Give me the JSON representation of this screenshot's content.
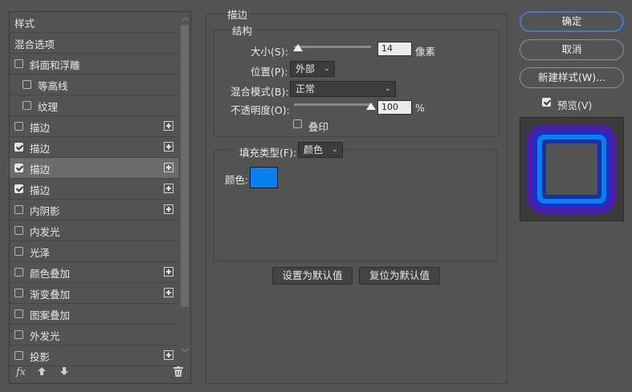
{
  "styles_list": {
    "items": [
      {
        "label": "样式",
        "checkbox": false,
        "checked": false,
        "plus": false,
        "indent": false,
        "selected": false
      },
      {
        "label": "混合选项",
        "checkbox": false,
        "checked": false,
        "plus": false,
        "indent": false,
        "selected": false
      },
      {
        "label": "斜面和浮雕",
        "checkbox": true,
        "checked": false,
        "plus": false,
        "indent": false,
        "selected": false
      },
      {
        "label": "等高线",
        "checkbox": true,
        "checked": false,
        "plus": false,
        "indent": true,
        "selected": false
      },
      {
        "label": "纹理",
        "checkbox": true,
        "checked": false,
        "plus": false,
        "indent": true,
        "selected": false
      },
      {
        "label": "描边",
        "checkbox": true,
        "checked": false,
        "plus": true,
        "indent": false,
        "selected": false
      },
      {
        "label": "描边",
        "checkbox": true,
        "checked": true,
        "plus": true,
        "indent": false,
        "selected": false
      },
      {
        "label": "描边",
        "checkbox": true,
        "checked": true,
        "plus": true,
        "indent": false,
        "selected": true
      },
      {
        "label": "描边",
        "checkbox": true,
        "checked": true,
        "plus": true,
        "indent": false,
        "selected": false
      },
      {
        "label": "内阴影",
        "checkbox": true,
        "checked": false,
        "plus": true,
        "indent": false,
        "selected": false
      },
      {
        "label": "内发光",
        "checkbox": true,
        "checked": false,
        "plus": false,
        "indent": false,
        "selected": false
      },
      {
        "label": "光泽",
        "checkbox": true,
        "checked": false,
        "plus": false,
        "indent": false,
        "selected": false
      },
      {
        "label": "颜色叠加",
        "checkbox": true,
        "checked": false,
        "plus": true,
        "indent": false,
        "selected": false
      },
      {
        "label": "渐变叠加",
        "checkbox": true,
        "checked": false,
        "plus": true,
        "indent": false,
        "selected": false
      },
      {
        "label": "图案叠加",
        "checkbox": true,
        "checked": false,
        "plus": false,
        "indent": false,
        "selected": false
      },
      {
        "label": "外发光",
        "checkbox": true,
        "checked": false,
        "plus": false,
        "indent": false,
        "selected": false
      },
      {
        "label": "投影",
        "checkbox": true,
        "checked": false,
        "plus": true,
        "indent": false,
        "selected": false
      }
    ],
    "footer": {
      "fx_label": "fx",
      "icons": [
        "fx-icon",
        "move-up-icon",
        "move-down-icon",
        "trash-icon"
      ]
    }
  },
  "stroke": {
    "title": "描边",
    "structure_title": "结构",
    "size_label": "大小(S):",
    "size_value": "14",
    "size_unit": "像素",
    "size_fraction": 0.05,
    "position_label": "位置(P):",
    "position_value": "外部",
    "blend_label": "混合模式(B):",
    "blend_value": "正常",
    "opacity_label": "不透明度(O):",
    "opacity_value": "100",
    "opacity_unit": "%",
    "opacity_fraction": 1.0,
    "overprint_label": "叠印",
    "overprint_checked": false,
    "fill_type_label": "填充类型(F):",
    "fill_type_value": "颜色",
    "color_label": "颜色:",
    "color_value": "#0b7ef0",
    "set_default_label": "设置为默认值",
    "reset_default_label": "复位为默认值"
  },
  "right": {
    "ok_label": "确定",
    "cancel_label": "取消",
    "new_style_label": "新建样式(W)...",
    "preview_label": "预览(V)",
    "preview_checked": true,
    "preview_colors": {
      "outer": "#4a1fa8",
      "middle": "#1a31c9",
      "inner_ring": "#0b7ef0",
      "core": "#535353",
      "inner_dark": "#1533a0"
    }
  }
}
